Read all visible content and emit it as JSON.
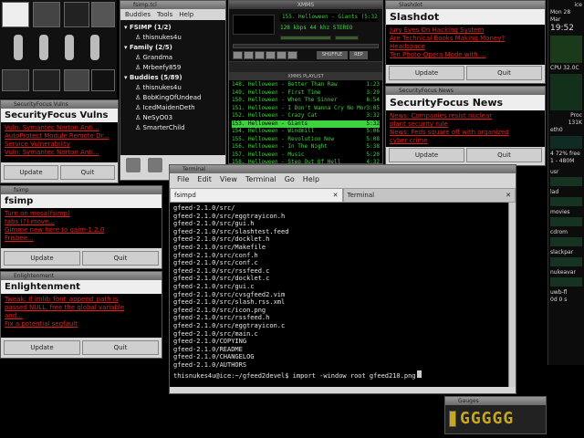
{
  "fsimp_buddy": {
    "title": "fsimp.tcl",
    "menu": [
      "Buddies",
      "Tools",
      "Help"
    ],
    "groups": [
      {
        "name": "FSIMP (1/2)",
        "members": [
          "thisnukes4u"
        ]
      },
      {
        "name": "Family (2/5)",
        "members": [
          "Grandma",
          "Mrbeefy859"
        ]
      },
      {
        "name": "Buddies (5/89)",
        "members": [
          "thisnukes4u",
          "BobKingOfUndead",
          "IcedMaidenDeth",
          "NeSyO03",
          "SmarterChild"
        ]
      }
    ]
  },
  "xmms": {
    "title": "XMMS",
    "display": "155. Helloween - Giants (5:32)",
    "kbps": "128",
    "khz": "44",
    "mode": "STEREO",
    "shuffle": "SHUFFLE",
    "rep": "REP",
    "playlist_title": "XMMS PLAYLIST",
    "playlist": [
      {
        "n": "148. Helloween - Better Than Raw",
        "t": "1:23"
      },
      {
        "n": "149. Helloween - First Time",
        "t": "3:29"
      },
      {
        "n": "150. Helloween - When The Sinner",
        "t": "6:54"
      },
      {
        "n": "151. Helloween - I Don't Wanna Cry No More",
        "t": "3:05"
      },
      {
        "n": "152. Helloween - Crazy Cat",
        "t": "3:32"
      },
      {
        "n": "153. Helloween - Giants",
        "t": "5:32"
      },
      {
        "n": "154. Helloween - Windmill",
        "t": "5:06"
      },
      {
        "n": "155. Helloween - Revolution Now",
        "t": "5:08"
      },
      {
        "n": "156. Helloween - In The Night",
        "t": "5:38"
      },
      {
        "n": "157. Helloween - Music",
        "t": "5:20"
      },
      {
        "n": "158. Helloween - Step Out Of Hell",
        "t": "4:32"
      }
    ]
  },
  "slashdot": {
    "title": "Slashdot",
    "links": [
      "Jury Eyes On Hacking System",
      "Are Technical Books Making Money?",
      "Headspace",
      "Ten Photo-Opera Mode with ..."
    ],
    "update": "Update",
    "quit": "Quit"
  },
  "sf_news": {
    "title": "SecurityFocus News",
    "links": [
      "News: Companies resist nuclear",
      "plant security rule",
      "News: Feds square off with organized",
      "cyber crime"
    ],
    "update": "Update",
    "quit": "Quit"
  },
  "sf_vulns": {
    "title": "SecurityFocus Vulns",
    "links": [
      "Vuln: Symantec Norton Anti...",
      "AutoProtect Module Remote Dr...",
      "Service Vulnerability",
      "Vuln: Symantec Norton Anti..."
    ],
    "update": "Update",
    "quit": "Quit"
  },
  "fsimp_feed": {
    "title": "fsimp",
    "links": [
      "Turn on mesa(fsimp)",
      "tabs (?) move...",
      "Gimme new here to gaim-1.2.0",
      "Frisbee..."
    ],
    "update": "Update",
    "quit": "Quit"
  },
  "enlightenment": {
    "title": "Enlightenment",
    "links": [
      "Tweak: If imlib_font_append_path is",
      "passed NULL, free the global variable",
      "and...",
      "Fix a potential segfault"
    ],
    "update": "Update",
    "quit": "Quit"
  },
  "terminal": {
    "title": "Terminal",
    "menu": [
      "File",
      "Edit",
      "View",
      "Terminal",
      "Go",
      "Help"
    ],
    "tabs": [
      "fsimpd",
      "Terminal"
    ],
    "lines": [
      "gfeed-2.1.0/src/",
      "gfeed-2.1.0/src/eggtrayicon.h",
      "gfeed-2.1.0/src/gui.h",
      "gfeed-2.1.0/src/slashtest.feed",
      "gfeed-2.1.0/src/docklet.h",
      "gfeed-2.1.0/src/Makefile",
      "gfeed-2.1.0/src/conf.h",
      "gfeed-2.1.0/src/conf.c",
      "gfeed-2.1.0/src/rssfeed.c",
      "gfeed-2.1.0/src/docklet.c",
      "gfeed-2.1.0/src/gui.c",
      "gfeed-2.1.0/src/cvsgfeed2.vim",
      "gfeed-2.1.0/src/slash.rss.xml",
      "gfeed-2.1.0/src/icon.png",
      "gfeed-2.1.0/src/rssfeed.h",
      "gfeed-2.1.0/src/eggtrayicon.c",
      "gfeed-2.1.0/src/main.c",
      "gfeed-2.1.0/COPYING",
      "gfeed-2.1.0/README",
      "gfeed-2.1.0/CHANGELOG",
      "gfeed-2.1.0/AUTHORS"
    ],
    "prompt": "thisnukes4u@ice:~/gfeed2devel$ import -window root gfeed210.png"
  },
  "sysmon": {
    "host": "ice",
    "date": "Mon 28 Mar",
    "time": "19:52",
    "cpu": "CPU 32.0C",
    "proc_label": "Proc",
    "mem": "131K",
    "eth": "eth0",
    "free": "4 72% free",
    "mem2": "1 - 480M",
    "disks": [
      {
        "name": "usr"
      },
      {
        "name": "lad"
      },
      {
        "name": "movies"
      },
      {
        "name": "cdrom"
      },
      {
        "name": "slackpar"
      },
      {
        "name": "nukeavar"
      }
    ],
    "uwb": "uwb-fl",
    "uwb_val": "0d 0 s"
  },
  "gauges": {
    "title": "Gauges",
    "digits": "GGGGG"
  },
  "colors": {
    "feed_link": "#d22222",
    "term_bg": "#000000",
    "xmms_green": "#3fd23f",
    "xmms_bg": "#111111"
  }
}
